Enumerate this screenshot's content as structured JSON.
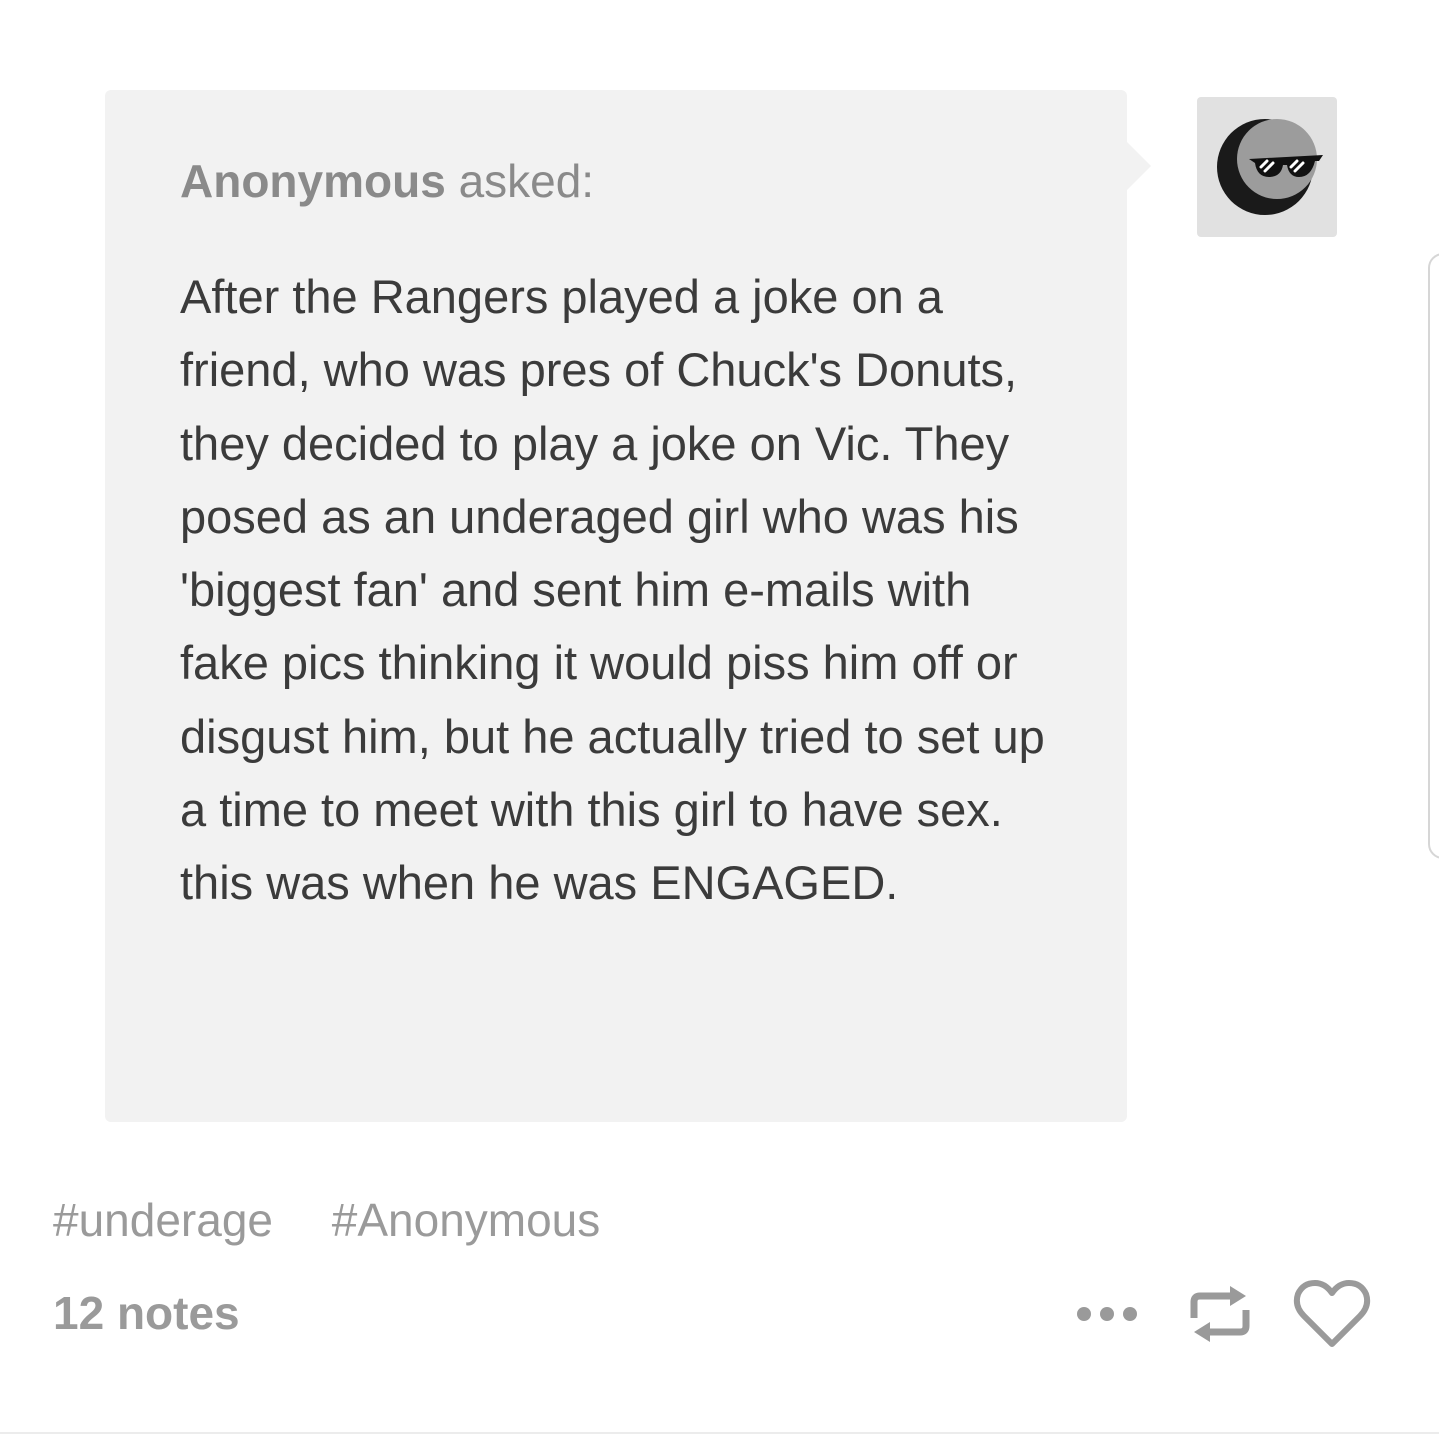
{
  "post": {
    "ask": {
      "asker": "Anonymous",
      "verb": "asked:",
      "question": "After the Rangers played a joke on a friend, who was pres of Chuck's Donuts, they decided to play a joke on Vic. They posed as an underaged girl who was his 'biggest fan' and sent him e-mails with fake pics thinking it would piss him off or disgust him, but he actually tried to set up a time to meet with this girl to have sex. this was when he was ENGAGED."
    },
    "avatar_icon": "moon-sunglasses-avatar",
    "tags": [
      "#underage",
      "#Anonymous"
    ],
    "notes": "12 notes",
    "actions": {
      "more_icon": "ellipsis-icon",
      "reblog_icon": "reblog-icon",
      "like_icon": "heart-icon"
    }
  },
  "colors": {
    "bubble_bg": "#f2f2f2",
    "body_text": "#3b3b3b",
    "meta_text": "#9a9a9a",
    "avatar_bg": "#e1e1e1"
  }
}
